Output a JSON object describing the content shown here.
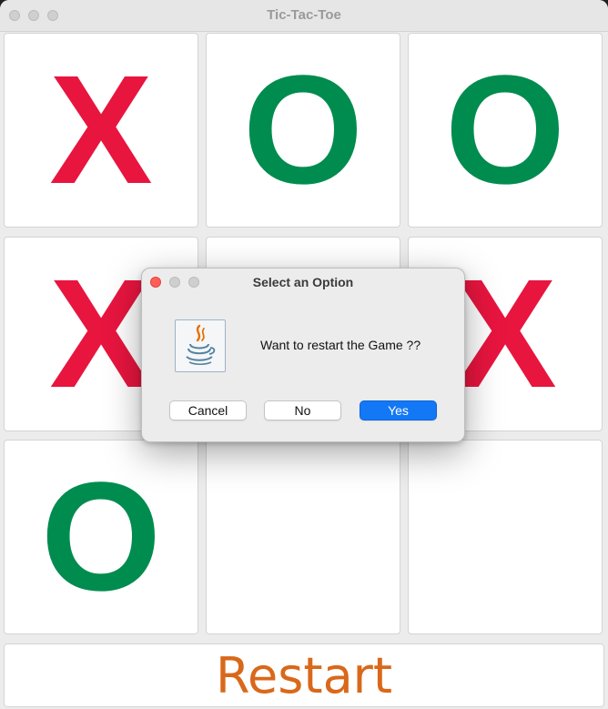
{
  "window": {
    "title": "Tic-Tac-Toe"
  },
  "board": {
    "cells": [
      "X",
      "O",
      "O",
      "X",
      "",
      "X",
      "O",
      "",
      ""
    ]
  },
  "restart_label": "Restart",
  "dialog": {
    "title": "Select an Option",
    "message": "Want to restart the Game ??",
    "icon": "java-icon",
    "buttons": {
      "cancel": "Cancel",
      "no": "No",
      "yes": "Yes"
    }
  },
  "colors": {
    "x": "#e8153f",
    "o": "#008c4f",
    "restart": "#d9681a",
    "primary_button": "#1378f6"
  }
}
